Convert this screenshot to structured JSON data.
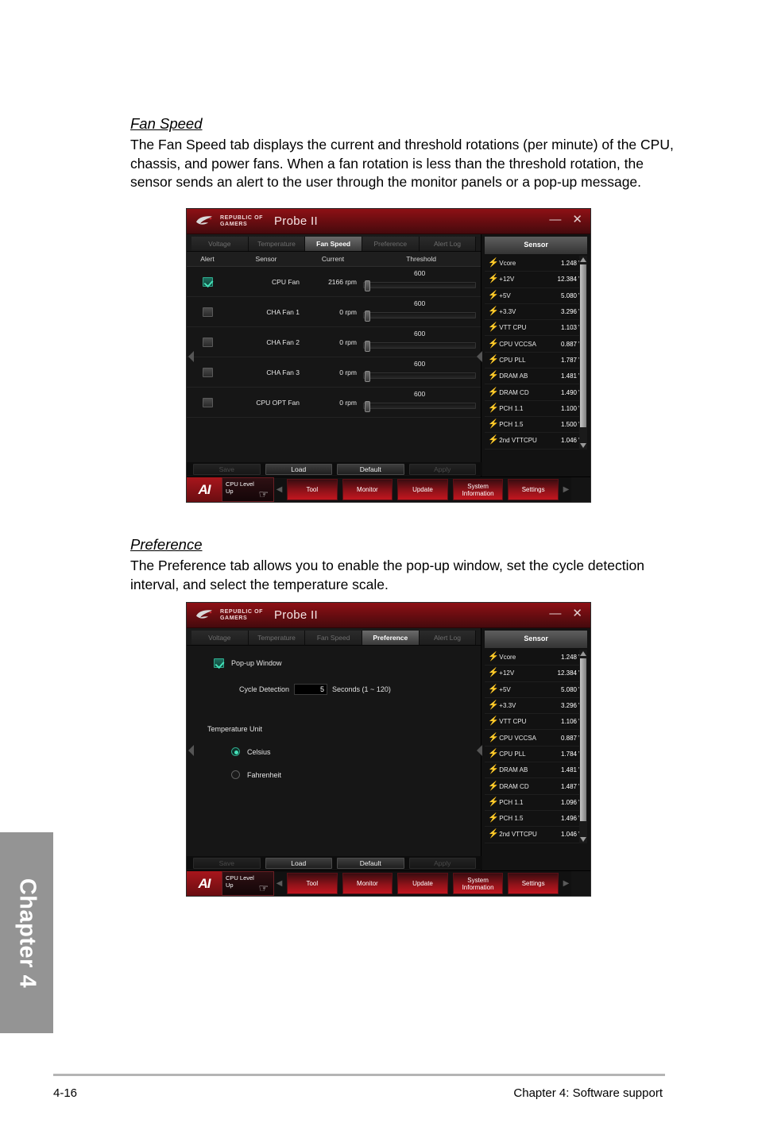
{
  "page": {
    "footer_page_number": "4-16",
    "footer_chapter": "Chapter 4: Software support",
    "side_tab": "Chapter 4"
  },
  "sections": [
    {
      "heading": "Fan Speed",
      "body": "The Fan Speed tab displays the current and threshold rotations (per minute) of the CPU, chassis, and power fans. When a fan rotation is less than the threshold rotation, the sensor sends an alert to the user through the monitor panels or a pop-up message."
    },
    {
      "heading": "Preference",
      "body": "The Preference tab allows you to enable the pop-up window, set the cycle detection interval, and select the temperature scale."
    }
  ],
  "app": {
    "brand_line1": "REPUBLIC OF",
    "brand_line2": "GAMERS",
    "title": "Probe II",
    "minimize": "—",
    "close": "✕",
    "tabs": [
      "Voltage",
      "Temperature",
      "Fan Speed",
      "Preference",
      "Alert Log"
    ],
    "sensor_panel_title": "Sensor",
    "actions": [
      {
        "label": "Save",
        "enabled": false
      },
      {
        "label": "Load",
        "enabled": true
      },
      {
        "label": "Default",
        "enabled": true
      },
      {
        "label": "Apply",
        "enabled": false
      }
    ],
    "navbar": {
      "logo": "AI",
      "cpu_level_up": "CPU Level Up",
      "items": [
        "Tool",
        "Monitor",
        "Update",
        "System Information",
        "Settings"
      ],
      "prev_arrow": "◀",
      "next_arrow": "▶"
    }
  },
  "fan_speed": {
    "active_tab": "Fan Speed",
    "columns": [
      "Alert",
      "Sensor",
      "Current",
      "Threshold"
    ],
    "rows": [
      {
        "alert": true,
        "sensor": "CPU Fan",
        "current": "2166 rpm",
        "threshold": "600"
      },
      {
        "alert": false,
        "sensor": "CHA Fan 1",
        "current": "0 rpm",
        "threshold": "600"
      },
      {
        "alert": false,
        "sensor": "CHA Fan 2",
        "current": "0 rpm",
        "threshold": "600"
      },
      {
        "alert": false,
        "sensor": "CHA Fan 3",
        "current": "0 rpm",
        "threshold": "600"
      },
      {
        "alert": false,
        "sensor": "CPU OPT Fan",
        "current": "0 rpm",
        "threshold": "600"
      }
    ],
    "sensors": [
      {
        "name": "Vcore",
        "value": "1.248",
        "unit": "V"
      },
      {
        "name": "+12V",
        "value": "12.384",
        "unit": "V"
      },
      {
        "name": "+5V",
        "value": "5.080",
        "unit": "V"
      },
      {
        "name": "+3.3V",
        "value": "3.296",
        "unit": "V"
      },
      {
        "name": "VTT CPU",
        "value": "1.103",
        "unit": "V"
      },
      {
        "name": "CPU VCCSA",
        "value": "0.887",
        "unit": "V"
      },
      {
        "name": "CPU PLL",
        "value": "1.787",
        "unit": "V"
      },
      {
        "name": "DRAM AB",
        "value": "1.481",
        "unit": "V"
      },
      {
        "name": "DRAM CD",
        "value": "1.490",
        "unit": "V"
      },
      {
        "name": "PCH 1.1",
        "value": "1.100",
        "unit": "V"
      },
      {
        "name": "PCH 1.5",
        "value": "1.500",
        "unit": "V"
      },
      {
        "name": "2nd VTTCPU",
        "value": "1.046",
        "unit": "V"
      }
    ]
  },
  "preference": {
    "active_tab": "Preference",
    "popup_window_label": "Pop-up Window",
    "popup_window_checked": true,
    "cycle_detection_label": "Cycle Detection",
    "cycle_detection_value": "5",
    "cycle_detection_suffix": "Seconds (1 ~ 120)",
    "temperature_unit_label": "Temperature Unit",
    "units": [
      {
        "label": "Celsius",
        "selected": true
      },
      {
        "label": "Fahrenheit",
        "selected": false
      }
    ],
    "sensors": [
      {
        "name": "Vcore",
        "value": "1.248",
        "unit": "V"
      },
      {
        "name": "+12V",
        "value": "12.384",
        "unit": "V"
      },
      {
        "name": "+5V",
        "value": "5.080",
        "unit": "V"
      },
      {
        "name": "+3.3V",
        "value": "3.296",
        "unit": "V"
      },
      {
        "name": "VTT CPU",
        "value": "1.106",
        "unit": "V"
      },
      {
        "name": "CPU VCCSA",
        "value": "0.887",
        "unit": "V"
      },
      {
        "name": "CPU PLL",
        "value": "1.784",
        "unit": "V"
      },
      {
        "name": "DRAM AB",
        "value": "1.481",
        "unit": "V"
      },
      {
        "name": "DRAM CD",
        "value": "1.487",
        "unit": "V"
      },
      {
        "name": "PCH 1.1",
        "value": "1.096",
        "unit": "V"
      },
      {
        "name": "PCH 1.5",
        "value": "1.496",
        "unit": "V"
      },
      {
        "name": "2nd VTTCPU",
        "value": "1.046",
        "unit": "V"
      }
    ]
  }
}
